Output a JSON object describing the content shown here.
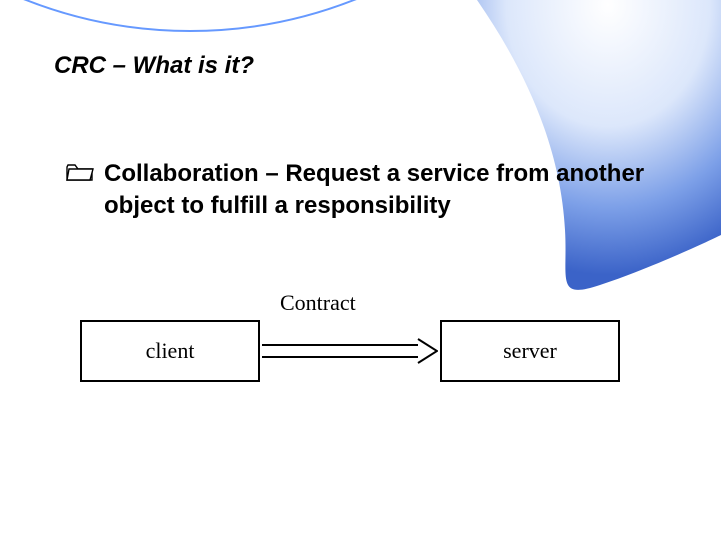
{
  "slide": {
    "title": "CRC – What is it?",
    "bullet": {
      "text": "Collaboration – Request a service from another object to fulfill a responsibility"
    },
    "diagram": {
      "client_label": "client",
      "server_label": "server",
      "contract_label": "Contract"
    }
  }
}
